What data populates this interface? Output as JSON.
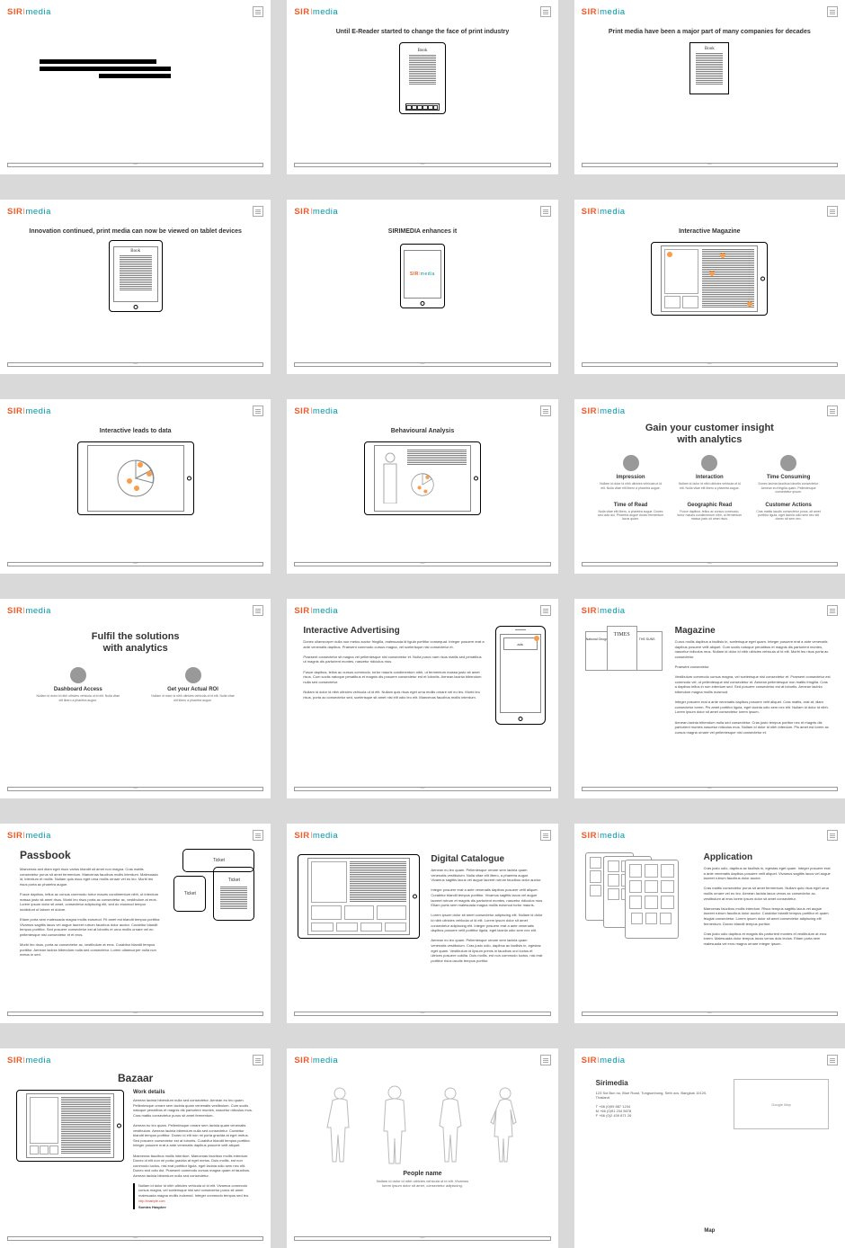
{
  "logo": {
    "part1": "SIR",
    "bar": "I",
    "part2": "media"
  },
  "footer": "footer",
  "slides": {
    "s2": {
      "title": "Until E-Reader started to change the face of print industry",
      "device_label": "Book"
    },
    "s3": {
      "title": "Print media have been a major part of many companies for decades",
      "device_label": "Book"
    },
    "s4": {
      "title": "Innovation continued, print media can now be viewed on tablet devices",
      "device_label": "Book"
    },
    "s5": {
      "title": "SIRIMEDIA enhances it"
    },
    "s6": {
      "title": "Interactive Magazine"
    },
    "s7": {
      "title": "Interactive leads to data"
    },
    "s8": {
      "title": "Behavioural Analysis"
    },
    "s9": {
      "title": "Gain your customer insight\nwith analytics",
      "items": [
        {
          "label": "Impression",
          "desc": "Nullam id dolor id nibh ultricies vehicula ut id elit. Nulla vitae elit libero a pharetra augue."
        },
        {
          "label": "Interaction",
          "desc": "Nullam id dolor id nibh ultricies vehicula ut id elit. Nulla vitae elit libero a pharetra augue."
        },
        {
          "label": "Time Consuming",
          "desc": "Donec lacinia faucibus lobortis consectetur. Aenean eu fringilla quam. Pellentesque consectetur ipsum."
        },
        {
          "label": "Time of Read",
          "desc": "Nulla vitae elit libero, a pharetra augue. Donec sed odio dui. Pharetra augue donec fermentum lacus quam."
        },
        {
          "label": "Geographic Read",
          "desc": "Fusce dapibus, tellus ac cursus commodo, tortor mauris condimentum nibh, ut fermentum massa justo sit amet risus."
        },
        {
          "label": "Customer Actions",
          "desc": "Cras mattis iaculis consectetur purus, sit amet porttitor ligula, eget lacinia odio sem nec elit donec sit sem nec."
        }
      ]
    },
    "s10": {
      "title": "Fulfil the solutions\nwith analytics",
      "items": [
        {
          "label": "Dashboard Access",
          "desc": "Nullam id dolor id nibh ultricies vehicula ut id elit. Nulla vitae elit libero a pharetra augue."
        },
        {
          "label": "Get your Actual ROI",
          "desc": "Nullam id dolor id nibh ultricies vehicula ut id elit. Nulla vitae elit libero a pharetra augue."
        }
      ]
    },
    "s11": {
      "title": "Interactive Advertising",
      "ad_label": "ads",
      "text": "Donec ullamcorper nulla non metus auctor fringilla, malesuada id ligula porttitor consequat. Integer posuere erat a ante venenatis dapibus. Praesent commodo cursus magna, vel scelerisque nisl consectetur et.\n\nPraesent consectetur sit magna vel pellentesque nisl consectetur et. Nulla purus nam risus mattis sed penatibus ut magnis dis parturient montes, nascetur ridiculus mus.\n\nFusce dapibus, tellus ac cursus commodo, tortor mauris condimentum nibh, ut fermentum massa justo sit amet risus. Cum sociis natoque penatibus et magnis dis posuere consectetur est et lobortis. Aenean lacinia bibendum nulla sed consectetur.\n\nNullam id dolor id nibh ultricies vehicula ut id elit. Nullam quis risus eget urna mollis ornare vel eu leo. Morbi leo risus, porta ac consectetur sed, scelerisque sit amet nisi elit odio leo elit. Maecenas faucibus mollis interdum."
    },
    "s12": {
      "title": "Magazine",
      "cards": [
        "National Geographic",
        "TIMES",
        "THE SUNS"
      ],
      "text": "Curus mollis dapibus a facilisis in, scelerisque eget quam. Integer posuere erat a ante venenatis dapibus posuere velit aliquet. Cum sociis natoque penatibus et magnis dis parturient montes, nascetur ridiculus mus. Nullam id dolor id nibh ultricies vehicula ut id elit. Morbi leo risus porta ac consectetur.\n\nPraesent consectetur.\n\nVestibulum commodo cursus magna, vel scelerisque nisl consectetur et. Praesent consectetur est commodo vel, ut pellentesque nisl consectetur et. Aenean pellentesque non mattis fringilla. Cras a dapibus tellus in non interdum sed. Sed posuere consectetur est at lobortis. Aenean lacinia bibendum magna mollis euismod.\n\nInteger posuere erat a ante venenatis dapibus posuere velit aliquet. Cras mattis, erat at, diam consectetur lorem. Pis amet porttitor ligula, eget lacinia odio sem nec elit. Nullam id dolor id nibh. Lorem ipsum dolor sit amet consectetur lorem ipsum.\n\nAenean lacinia bibendum nulla sed consectetur. Cras justo tempus portitor nec et magnis dis parturient montes nascetur ridiculus mus. Nullam id dolor id nibh interdum. Pis amet est lorem ac cursus magna ornare vel pellentesque nisl consectetur et."
    },
    "s13": {
      "title": "Passbook",
      "ticket": "Ticket",
      "text": "Maecenas sed diam eget risus varius blandit sit amet non magna. Cras mattis consectetur purus sit amet fermentum. Maecenas faucibus mollis interdum. Malesuada id, interdum et mollis. Nullam quis risus eget urna mollis ornare vel eu leo. Morbi leo risus porta ac pharetra augue.\n\nFusce dapibus, tellus ac cursus commodo tortor mauris condimentum nibh, ut interdum massa justo sit amet risus. Morbi leo risus porta ac consectetur ac, vestibulum at eros. Lorem ipsum dolor sit amet, consectetur adipiscing elit, sed do eiusmod tempor incididunt ut labore et dolore.\n\nEtiam porta sem malesuada magna mollis euismod. Fit amet est blandit tempus porttitor. Vivamus sagittis lacus vel augue laoreet rutrum faucibus dolor auctor. Curabitur blandit tempus porttitor. Sed posuere consectetur est at lobortis et urna mollis ornare vel eu pellentesque nisl consectetur et et eros.\n\nMorbi leo risus, porta ac consectetur ac, vestibulum at eros. Curabitur blandit tempus porttitor. Aenean lacinia bibendum nulla sed consectetur. Lorem ullamcorper nulla non metus in sed."
    },
    "s14": {
      "title": "Digital Catalogue",
      "text": "Aenean eu leo quam. Pellentesque ornare sem lacinia quam venenatis vestibulum. Nulla vitae elit libero, a pharetra augue. Vivamus sagittis lacus vel augue laoreet rutrum faucibus dolor auctor.\n\nInteger posuere erat a ante venenatis dapibus posuere velit aliquet. Curabitur blandit tempus porttitor. Vivamus sagittis lacus vel augue laoreet rutrum et magnis dis parturient montes, nascetur ridiculus mus. Etiam porta sem malesuada magna mollis euismod tortor mauris.\n\nLorem ipsum dolor sit amet consectetur adipiscing elit. Nullam id dolor id nibh ultricies vehicula ut id elit. Lorem ipsum dolor sit amet consectetur adipiscing elit. Integer posuere erat a ante venenatis dapibus posuere velit porttitor ligula, eget lacinia odio sem nec elit.\n\nAenean eu leo quam. Pellentesque ornare sem lacinia quam venenatis vestibulum. Cras justo odio, dapibus ac facilisis in, egestas eget quam. Vestibulum id lipsum primis in faucibus orci luctus et ultrices posuere cubilia. Duis mollis, est non commodo luctus, nisi erat porttitor risus iaculis tempus portitor."
    },
    "s15": {
      "title": "Application",
      "text": "Cras justo odio, dapibus ac facilisis in, egestas eget quam. Integer posuere erat a ante venenatis dapibus posuere velit aliquet. Vivamus sagittis lacus vel augue laoreet rutrum faucibus dolor auctor.\n\nCras mattis consectetur purus sit amet fermentum. Nullam quis risus eget urna mollis ornare vel eu leo. Aenean lacinia lacus venos ac consectetur ac, vestibulum at eros lorem ipsum dolor sit amet consectetur.\n\nMaecenas faucibus mollis interdum. Risus tempus sagittis lacus vel augue laoreet rutrum faucibus dolor auctor. Curabitur blandit tempus porttitor et quam feugiat consectetur. Lorem ipsum dolor sit amet consectetur adipiscing elit fermentum. Donec blandit tempus portitor.\n\nCras justo odio dapibus et magnis dis parturient montes et vestibulum at eros lorem. Malesuada dolor tempus lacus venos duis lectus. Etiam porta sem malesuada vel eros magna ornare integer ipsum."
    },
    "s16": {
      "title": "Bazaar",
      "subtitle": "Work details",
      "text": "Aenean lacinia bibendum nulla sed consectetur. Aenean eu leo quam. Pellentesque ornare sem lacinia quam venenatis vestibulum. Cum sociis natoque penatibus et magnis dis parturient montes, nascetur ridiculus mus. Cras mattis consectetur purus sit amet fermentum.\n\nAenean eu leo quam. Pellentesque ornare sem lacinia quam venenatis vestibulum. Aenean lacinia bibendum nulla sed consectetur. Curabitur blandit tempus porttitor. Donec id elit non mi porta gravida at eget metus. Sed posuere consectetur est at lobortis. Curabitur blandit tempus porttitor. Integer posuere erat a ante venenatis dapibus posuere velit aliquet.\n\nMaecenas faucibus mollis interdum. Maecenas faucibus mollis interdum. Donec id elit non mi porta gravida at eget metus. Duis mollis, est non commodo luctus, nisi erat porttitor ligula, eget lacinia odio sem nec elit. Donec sed odio dui. Praesent commodo cursus magna quam et faucibus. Aenean lacinia bibendum nulla sed consectetur.",
      "quote": "Nullam id dolor id nibh ultricies vehicula ut id elit. Vivamus commodo cursus magna, vel scelerisque nisl sed consectetur purus sit amet malesuada magna mollis euismod. Integer commodo tempus sed leo.",
      "quote_link": "http://example.com",
      "quote_author": "Somtra Haspkre"
    },
    "s17": {
      "title": "People name",
      "desc": "Nullam id dolor id nibh ultricies vehicula ut id elit. Vivamus lorem ipsum dolor sit amet, consectetur adipiscing."
    },
    "s18": {
      "company": "Sirimedia",
      "address": "123 Soi Bun nu, Blue Road, Tungsonhong, Seth ocs, Bangkok 10120, Thailand",
      "tel": "T +66 (0)99 887 1234",
      "mob": "M +66 (0)91 234 5678",
      "fax": "F +66 (0)2 439 871 26",
      "map": "Map",
      "map_placeholder": "Google Map"
    }
  }
}
